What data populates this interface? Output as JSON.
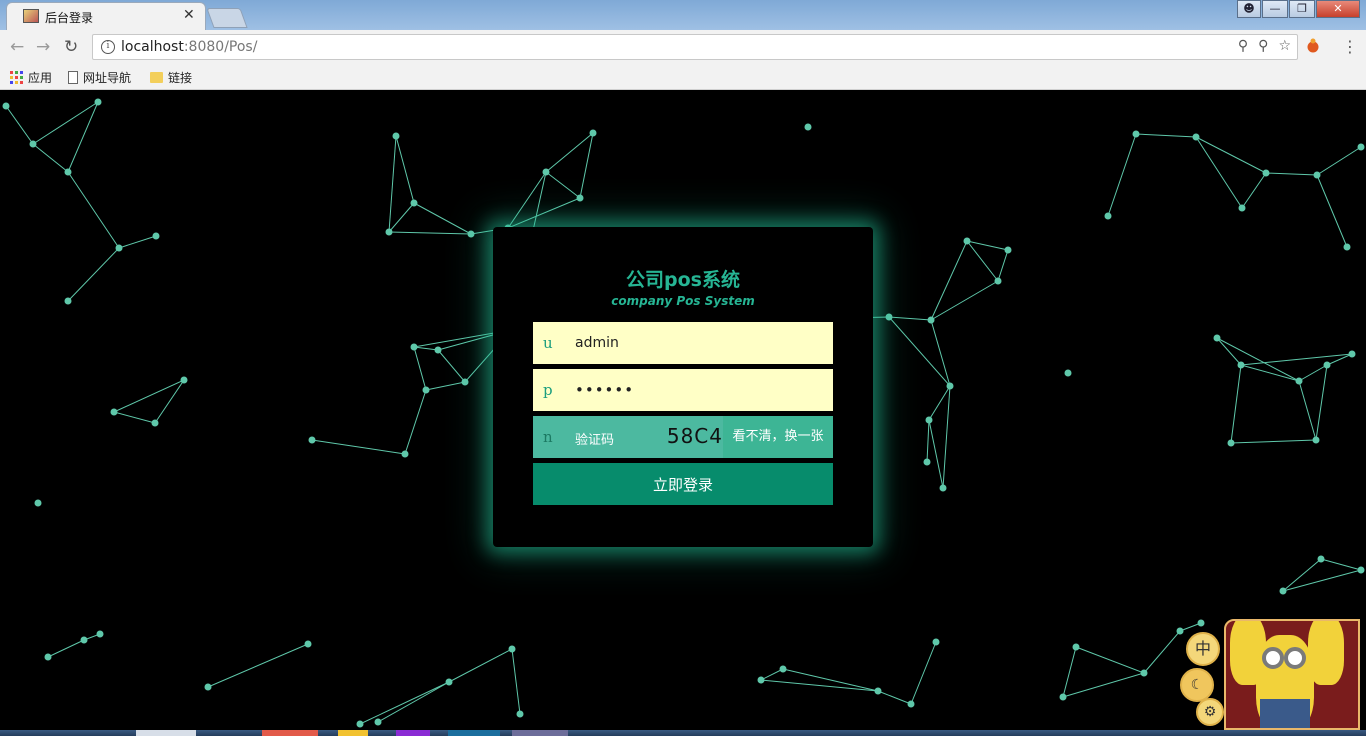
{
  "browser": {
    "tab_title": "后台登录",
    "close_glyph": "✕",
    "url_host": "localhost",
    "url_rest": ":8080/Pos/",
    "window_buttons": [
      "—",
      "❐",
      "✕"
    ],
    "bookmarks": [
      "应用",
      "网址导航",
      "链接"
    ]
  },
  "brand": {
    "title": "公司pos系统",
    "subtitle": "company Pos System"
  },
  "form": {
    "username_icon": "u",
    "username_value": "admin",
    "password_icon": "p",
    "password_value": "••••••",
    "captcha_icon": "n",
    "captcha_label": "验证码",
    "captcha_code": "58C4",
    "captcha_refresh": "看不清，换一张",
    "submit_label": "立即登录"
  },
  "widget": {
    "lang_label": "中",
    "night_label": "☾",
    "settings_label": "⚙"
  },
  "colors": {
    "accent": "#26b594",
    "button": "#078c6c",
    "input_bg": "#ffffc6",
    "captcha_bg": "#4cb9a0",
    "network": "#5fc8aa"
  }
}
